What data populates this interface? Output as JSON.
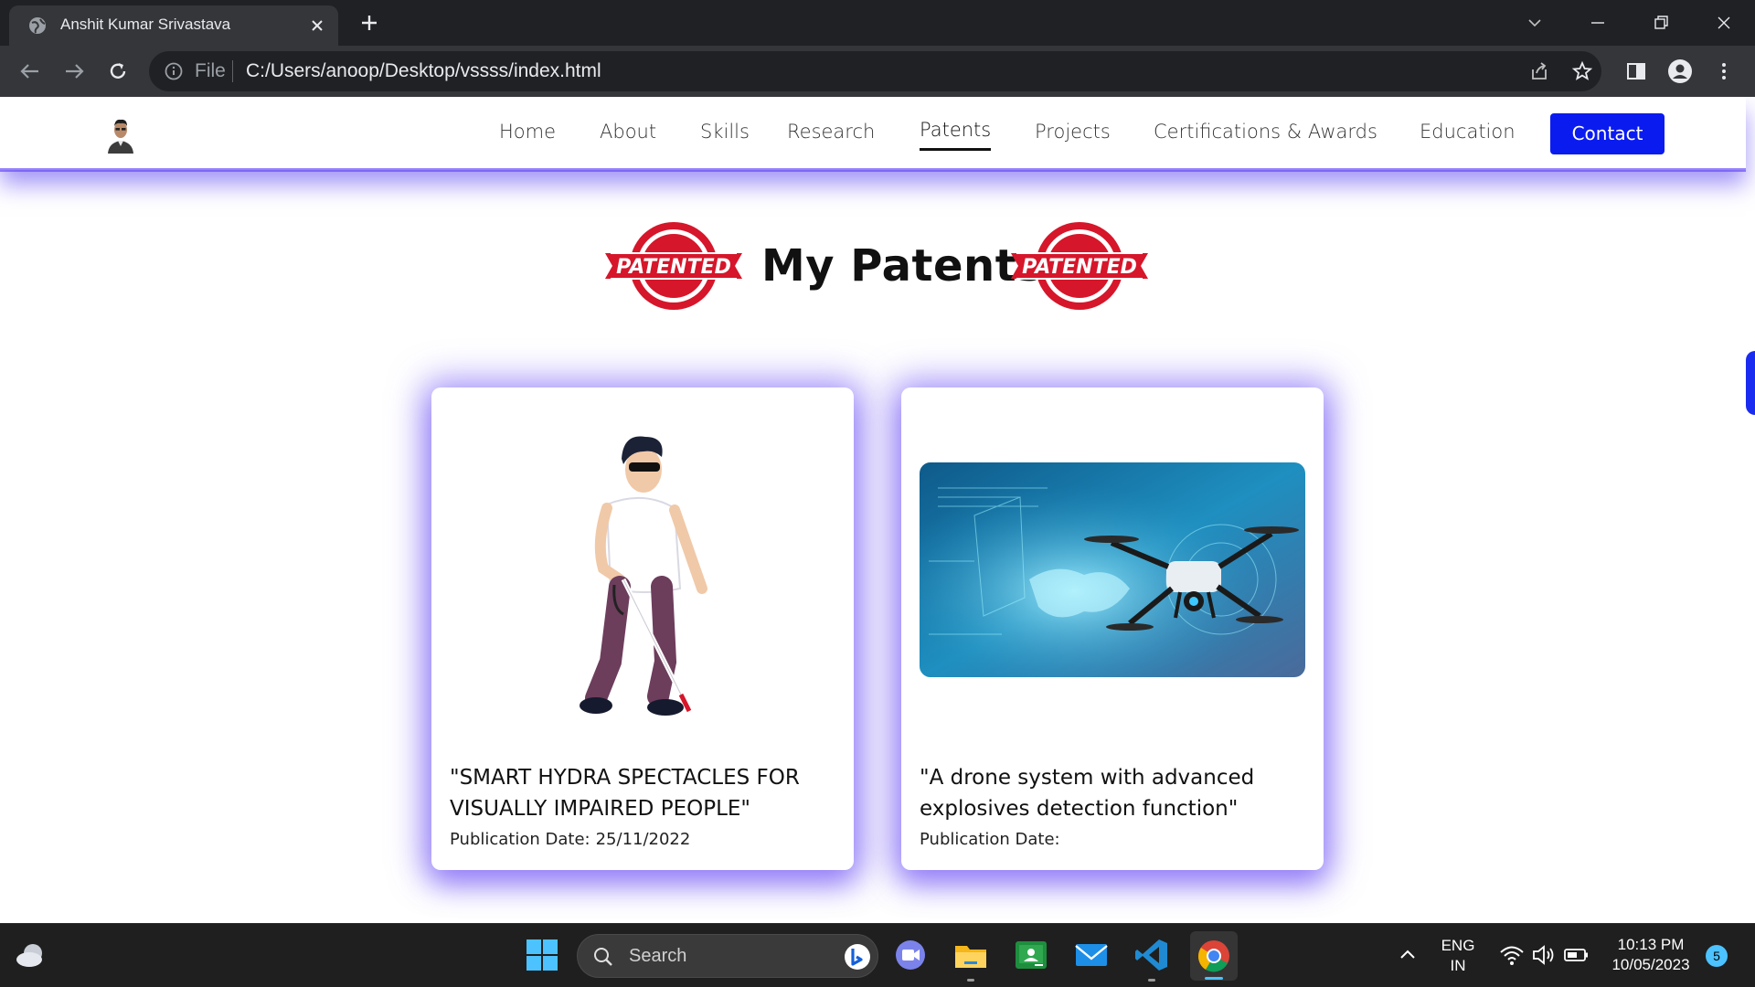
{
  "browser": {
    "tab_title": "Anshit Kumar Srivastava",
    "omnibox_scheme": "File",
    "url": "C:/Users/anoop/Desktop/vssss/index.html"
  },
  "site": {
    "nav": [
      "Home",
      "About",
      "Skills",
      "Research",
      "Patents",
      "Projects",
      "Certifications & Awards",
      "Education"
    ],
    "active_nav": "Patents",
    "contact_label": "Contact"
  },
  "section": {
    "title": "My Patents",
    "badge_text": "PATENTED"
  },
  "patents": [
    {
      "title": "\"SMART HYDRA SPECTACLES FOR VISUALLY IMPAIRED PEOPLE\"",
      "date_label": "Publication Date:",
      "date_value": "25/11/2022",
      "image": "blind-man-with-cane-illustration"
    },
    {
      "title": "\"A drone system with advanced explosives detection function\"",
      "date_label": "Publication Date:",
      "date_value": "",
      "image": "drone-hologram-photo"
    }
  ],
  "taskbar": {
    "search_label": "Search",
    "lang_line1": "ENG",
    "lang_line2": "IN",
    "time": "10:13 PM",
    "date": "10/05/2023",
    "notification_count": "5"
  },
  "colors": {
    "accent": "#0a1bf0",
    "glow": "#6a4ff7",
    "badge_red": "#d6162a"
  }
}
